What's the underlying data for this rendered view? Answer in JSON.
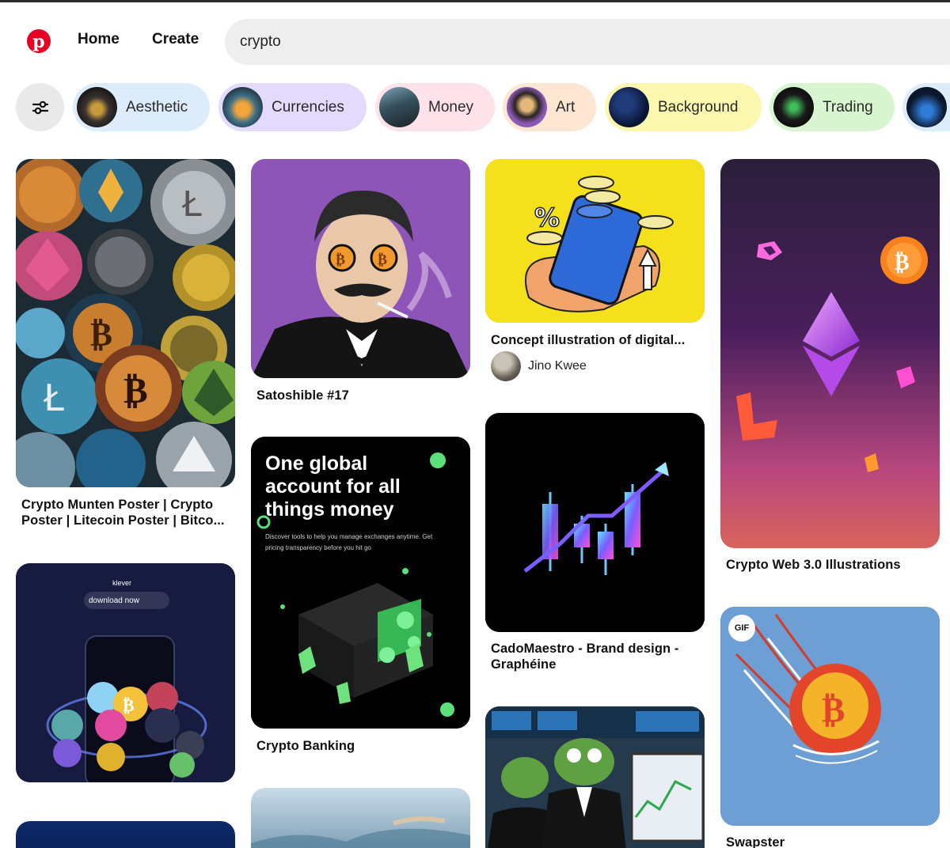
{
  "header": {
    "logo_letter": "p",
    "nav_home": "Home",
    "nav_create": "Create",
    "search_value": "crypto"
  },
  "chips": [
    {
      "label": "Aesthetic",
      "bg": "#dcecfb"
    },
    {
      "label": "Currencies",
      "bg": "#e3dafc"
    },
    {
      "label": "Money",
      "bg": "#fde2ea"
    },
    {
      "label": "Art",
      "bg": "#fde6d2"
    },
    {
      "label": "Background",
      "bg": "#fbf7ae"
    },
    {
      "label": "Trading",
      "bg": "#d7f6cf"
    }
  ],
  "pins": {
    "crypto_munten": {
      "caption": "Crypto Munten Poster | Crypto Poster | Litecoin Poster | Bitco..."
    },
    "satoshible": {
      "caption": "Satoshible #17"
    },
    "concept": {
      "caption": "Concept illustration of digital...",
      "author": "Jino Kwee"
    },
    "web3": {
      "caption": "Crypto Web 3.0 Illustrations"
    },
    "banking": {
      "caption": "Crypto Banking",
      "headline": "One global account for all things money",
      "subtext": "Discover tools to help you manage exchanges anytime. Get pricing transparency before you hit go"
    },
    "cadomaestro": {
      "caption": "CadoMaestro - Brand design - Graphéine"
    },
    "klever": {
      "brand": "klever",
      "button": "download now"
    },
    "swapster": {
      "caption": "Swapster",
      "badge": "GIF"
    }
  }
}
